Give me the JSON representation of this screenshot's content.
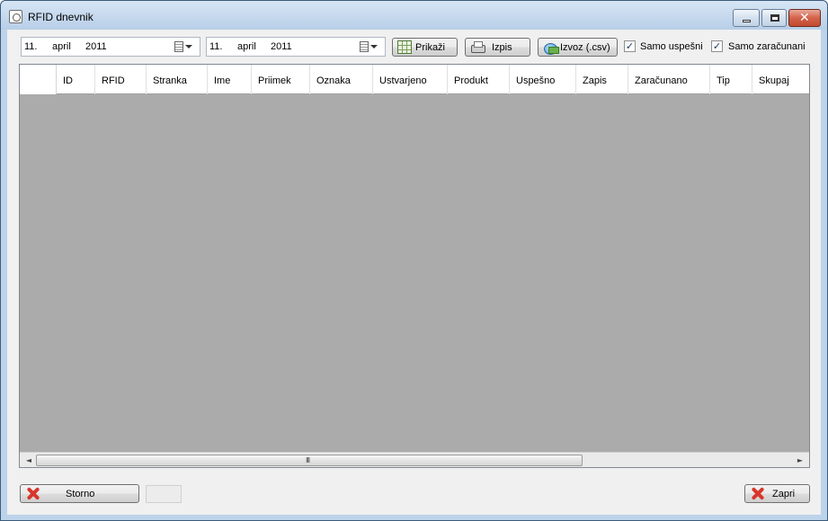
{
  "window": {
    "title": "RFID dnevnik",
    "controls": {
      "minimize": "minimize",
      "maximize": "maximize",
      "close": "✕"
    }
  },
  "toolbar": {
    "date_from": {
      "day": "11.",
      "month": "april",
      "year": "2011"
    },
    "date_to": {
      "day": "11.",
      "month": "april",
      "year": "2011"
    },
    "show_label": "Prikaži",
    "print_label": "Izpis",
    "export_label": "Izvoz (.csv)",
    "only_successful": {
      "label": "Samo uspešni",
      "checked": true,
      "mark": "✓"
    },
    "only_billed": {
      "label": "Samo zaračunani",
      "checked": true,
      "mark": "✓"
    }
  },
  "grid": {
    "columns": [
      "ID",
      "RFID",
      "Stranka",
      "Ime",
      "Priimek",
      "Oznaka",
      "Ustvarjeno",
      "Produkt",
      "Uspešno",
      "Zapis",
      "Zaračunano",
      "Tip",
      "Skupaj"
    ],
    "rows": []
  },
  "scrollbar": {
    "left_arrow": "◄",
    "right_arrow": "►",
    "grip": "III"
  },
  "footer": {
    "cancel_label": "Storno",
    "close_label": "Zapri",
    "status_text": ""
  },
  "colors": {
    "grid_background": "#ababab",
    "client_background": "#f0f0f0",
    "title_bar": "#c3d7ed"
  }
}
